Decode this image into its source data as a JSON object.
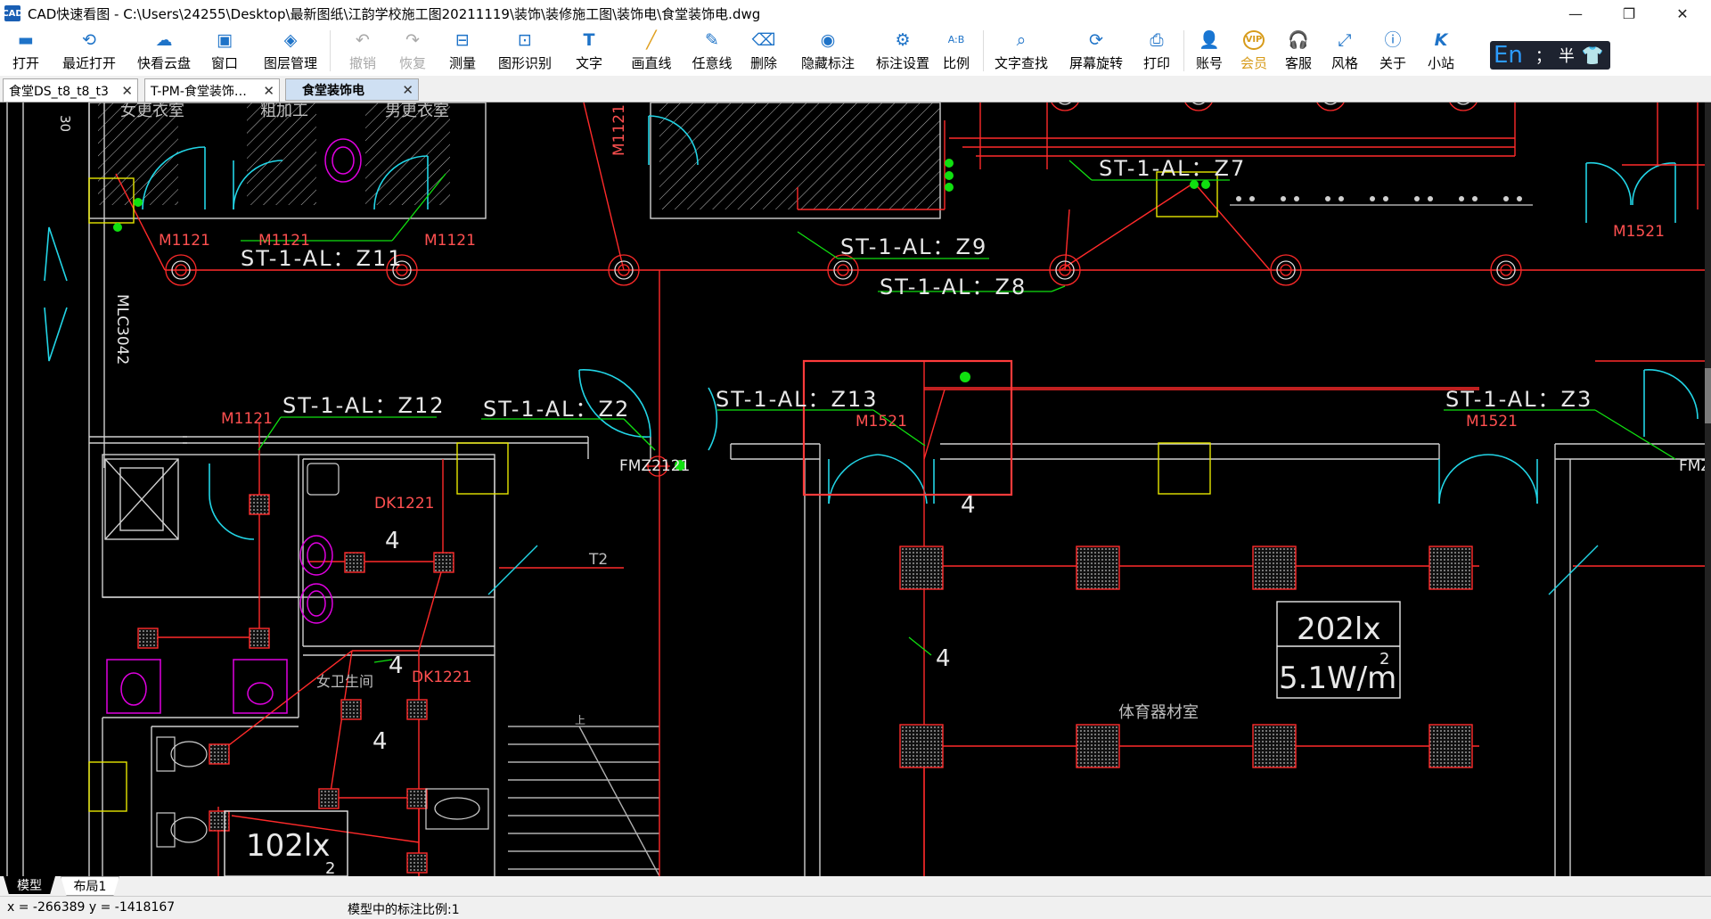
{
  "window": {
    "title": "CAD快速看图 - C:\\Users\\24255\\Desktop\\最新图纸\\江韵学校施工图20211119\\装饰\\装修施工图\\装饰电\\食堂装饰电.dwg",
    "app_icon": "cad-app-icon"
  },
  "toolbar": {
    "open": "打开",
    "recent": "最近打开",
    "cloud": "快看云盘",
    "window": "窗口",
    "layers": "图层管理",
    "undo": "撤销",
    "redo": "恢复",
    "measure": "测量",
    "shape_recog": "图形识别",
    "text": "文字",
    "draw_line": "画直线",
    "any_line": "任意线",
    "delete": "删除",
    "hide_dim": "隐藏标注",
    "dim_settings": "标注设置",
    "scale": "比例",
    "text_search": "文字查找",
    "rotate": "屏幕旋转",
    "print": "打印",
    "account": "账号",
    "vip": "会员",
    "service": "客服",
    "style": "风格",
    "about": "关于",
    "station": "小站"
  },
  "ime": {
    "mode": "En",
    "punct": "；",
    "width": "半"
  },
  "tabs": [
    {
      "label": "食堂DS_t8_t8_t3"
    },
    {
      "label": "T-PM-食堂装饰…"
    },
    {
      "label": "食堂装饰电"
    }
  ],
  "drawing": {
    "labels": {
      "r30": "30",
      "female_changing": "女更衣室",
      "coarse_proc": "粗加工",
      "male_changing": "男更衣室",
      "m1121_a": "M1121",
      "m1121_b": "M1121",
      "m1121_c": "M1121",
      "m1121_d": "M1121",
      "m1121_v": "M1121",
      "z11": "ST-1-AL：Z11",
      "z9": "ST-1-AL：Z9",
      "z8": "ST-1-AL：Z8",
      "z7": "ST-1-AL：Z7",
      "z12": "ST-1-AL：Z12",
      "z2": "ST-1-AL：Z2",
      "z13": "ST-1-AL：Z13",
      "z3": "ST-1-AL：Z3",
      "m1521_a": "M1521",
      "m1521_b": "M1521",
      "m1521_c": "M1521",
      "mlc": "MLC3042",
      "fmz": "FMZ2121",
      "fmz_r": "FMZ",
      "dk1221_a": "DK1221",
      "dk1221_b": "DK1221",
      "t2": "T2",
      "w4_a": "4",
      "w4_b": "4",
      "w4_c": "4",
      "w4_d": "4",
      "w4_e": "4",
      "lux_1": "202lx",
      "watt_1": "5.1W/m",
      "sup_2": "2",
      "lux_2": "102lx",
      "sup_3": "2",
      "sports_room": "体育器材室",
      "women_wc": "女卫生间",
      "up": "上"
    }
  },
  "layout_tabs": {
    "model": "模型",
    "layout1": "布局1"
  },
  "status": {
    "coords": "x = -266389  y = -1418167",
    "scale_text": "模型中的标注比例:1"
  },
  "colors": {
    "canvas_bg": "#000000",
    "red": "#ff2a2a",
    "cyan": "#22d5e6",
    "green": "#10e010",
    "yellow": "#e6e600",
    "magenta": "#e000e0",
    "white": "#e8e8e8",
    "highlight": "#ff3b3b"
  }
}
